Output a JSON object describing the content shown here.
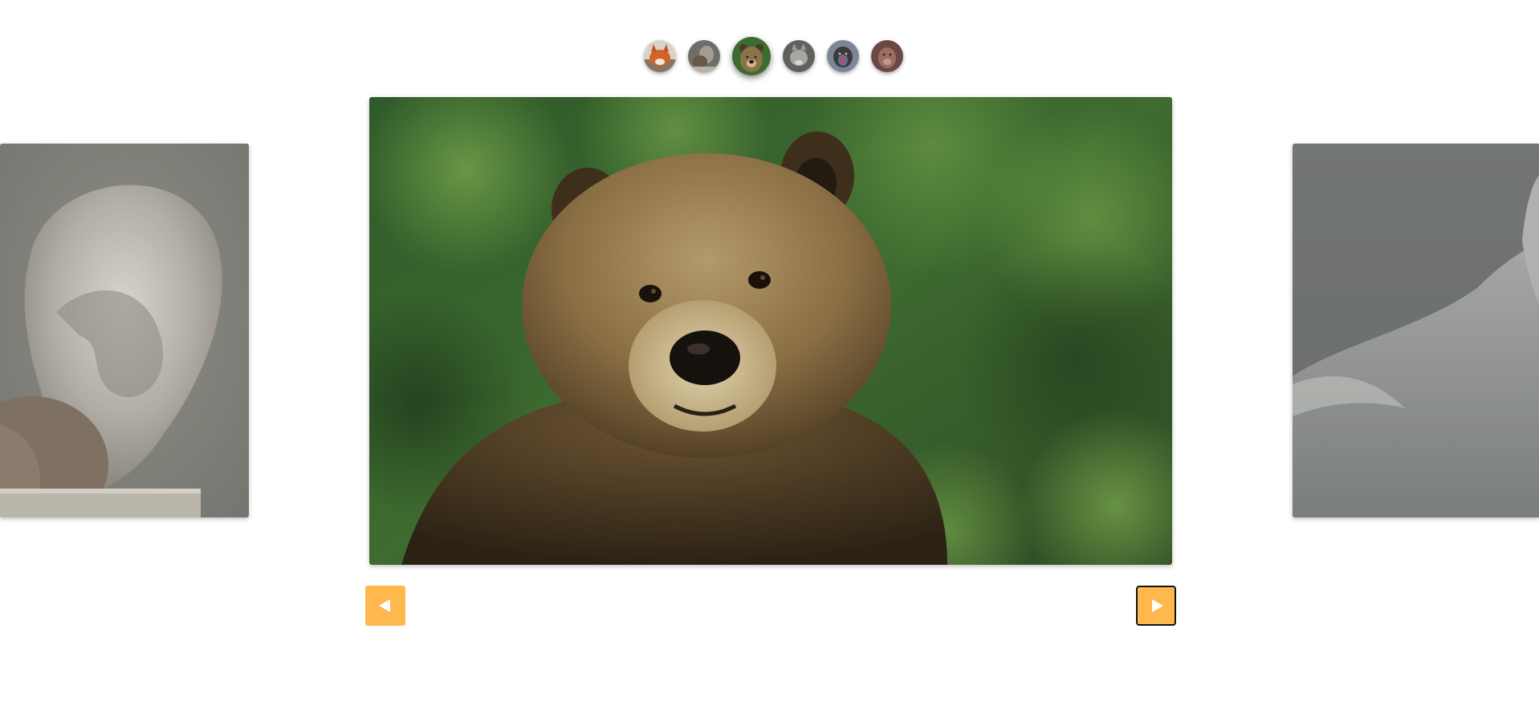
{
  "carousel": {
    "accent_color": "#ffb84d",
    "focus_outline_color": "#111111",
    "thumbnails": [
      {
        "icon": "fox-thumbnail",
        "active": false
      },
      {
        "icon": "squirrel-thumbnail",
        "active": false
      },
      {
        "icon": "bear-thumbnail",
        "active": true
      },
      {
        "icon": "wolf-thumbnail",
        "active": false
      },
      {
        "icon": "monkey-thumbnail",
        "active": false
      },
      {
        "icon": "animal-thumbnail",
        "active": false
      }
    ],
    "slides": {
      "previous": {
        "icon": "squirrel-image"
      },
      "current": {
        "icon": "bear-image"
      },
      "next": {
        "icon": "wolf-image"
      }
    },
    "prev_button": {
      "icon": "left-arrow-icon"
    },
    "next_button": {
      "icon": "right-arrow-icon"
    }
  }
}
